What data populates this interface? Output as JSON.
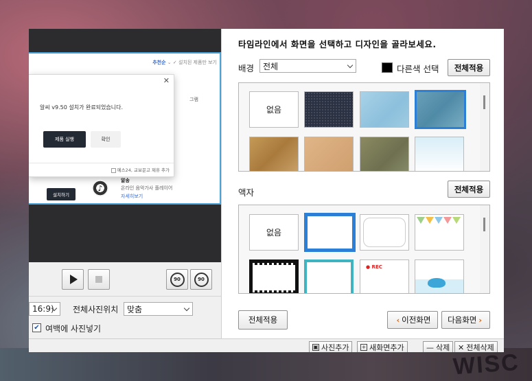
{
  "preview": {
    "sort_label": "추천순",
    "header_tail": "설치된 제품만 보기",
    "dialog_message": "알씨 v9.50 설치가 완료되었습니다.",
    "run_button": "제품 실행",
    "ok_button": "확인",
    "footer_text": "예스24, 교보문고 제휴 추가",
    "install_button": "설치하기",
    "app_name": "알송",
    "app_desc": "온라인 음악가사 플레이어",
    "app_link": "자세히보기",
    "side_fragment": "그램"
  },
  "playback": {
    "rotate_left": "90",
    "rotate_right": "90"
  },
  "options": {
    "ratio_value": "16:9)",
    "position_label": "전체사진위치",
    "position_value": "맞춤",
    "fill_margin_label": "여백에 사진넣기",
    "fill_margin_checked": true
  },
  "design": {
    "title": "타임라인에서 화면을 선택하고 디자인을 골라보세요.",
    "background_label": "배경",
    "background_select": "전체",
    "other_color_label": "다른색 선택",
    "apply_all": "전체적용",
    "none_tile": "없음",
    "frame_label": "액자",
    "frame_apply_all": "전체적용",
    "bottom_apply_all": "전체적용",
    "prev_screen": "이전화면",
    "next_screen": "다음화면",
    "rec_text": "REC",
    "swatch_color": "#000000",
    "accent_color": "#2b7fd6"
  },
  "bottom_toolbar": {
    "add_photo": "사진추가",
    "new_screen": "새화면추가",
    "delete": "삭제",
    "delete_all": "전체삭제"
  },
  "backdrop": {
    "bottom_text": "WISC"
  }
}
